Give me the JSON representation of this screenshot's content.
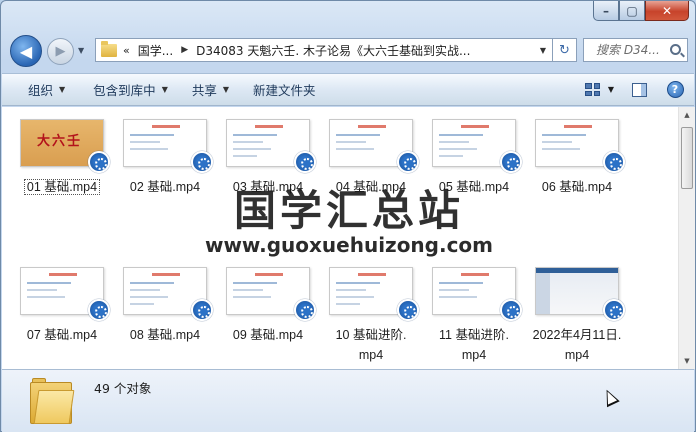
{
  "address": {
    "crumb1": "国学...",
    "crumb2": "D34083 天魁六壬. 木子论易《大六壬基础到实战..."
  },
  "search": {
    "placeholder": "搜索 D34..."
  },
  "toolbar": {
    "organize": "组织",
    "include_in_library": "包含到库中",
    "share": "共享",
    "new_folder": "新建文件夹"
  },
  "files": [
    {
      "name": "01 基础.mp4",
      "thumb": "title-gold",
      "thumb_text": "大六壬"
    },
    {
      "name": "02 基础.mp4",
      "thumb": "slide"
    },
    {
      "name": "03 基础.mp4",
      "thumb": "slide"
    },
    {
      "name": "04 基础.mp4",
      "thumb": "slide"
    },
    {
      "name": "05 基础.mp4",
      "thumb": "slide"
    },
    {
      "name": "06 基础.mp4",
      "thumb": "slide"
    },
    {
      "name": "07 基础.mp4",
      "thumb": "slide"
    },
    {
      "name": "08 基础.mp4",
      "thumb": "slide"
    },
    {
      "name": "09 基础.mp4",
      "thumb": "slide"
    },
    {
      "name": "10 基础进阶.mp4",
      "name_line1": "10 基础进阶.",
      "name_line2": "mp4",
      "thumb": "slide"
    },
    {
      "name": "11 基础进阶.mp4",
      "name_line1": "11 基础进阶.",
      "name_line2": "mp4",
      "thumb": "slide"
    },
    {
      "name": "2022年4月11日.mp4",
      "name_line1": "2022年4月11日.",
      "name_line2": "mp4",
      "thumb": "screen"
    }
  ],
  "watermark": {
    "title": "国学汇总站",
    "url": "www.guoxuehuizong.com"
  },
  "status": {
    "item_count": "49 个对象"
  },
  "colors": {
    "accent": "#2c72c7",
    "close": "#c7432b"
  }
}
